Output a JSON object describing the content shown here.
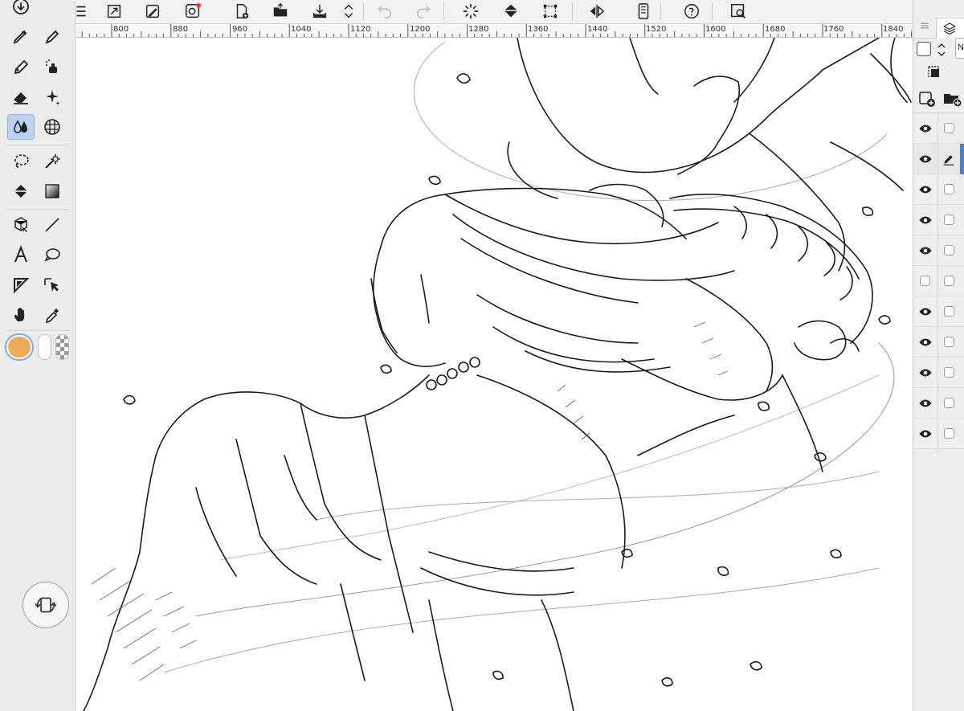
{
  "ruler": {
    "labels": [
      "800",
      "880",
      "960",
      "1040",
      "1120",
      "1200",
      "1280",
      "1360",
      "1440",
      "1520",
      "1600",
      "1680",
      "1760",
      "1840"
    ]
  },
  "layer_panel": {
    "blend_mode": "No"
  },
  "colors": {
    "main_color": "#f0ac5b",
    "active_tool_bg": "#bcd3ee"
  },
  "tools": [
    "transform-icon",
    "pen-icon",
    "pencil-icon",
    "brush-icon",
    "airbrush-icon",
    "eraser-icon",
    "decoration-icon",
    "blend-icon",
    "mesh-icon",
    "lasso-icon",
    "magic-wand-icon",
    "fill-icon",
    "gradient-icon",
    "3d-object-icon",
    "line-icon",
    "text-icon",
    "speech-balloon-icon",
    "ruler-icon",
    "object-select-icon",
    "hand-icon",
    "eyedropper-icon"
  ],
  "top_toolbar": [
    "menu-icon",
    "fit-canvas-icon",
    "copy-layer-icon",
    "clip-studio-icon",
    "new-file-icon",
    "open-folder-icon",
    "save-icon",
    "undo-icon",
    "redo-icon",
    "loading-icon",
    "fill-bucket-icon",
    "crop-icon",
    "flip-icon",
    "device-icon",
    "help-icon",
    "search-icon"
  ]
}
